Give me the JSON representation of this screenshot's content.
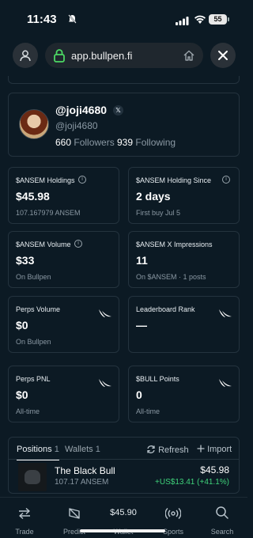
{
  "status": {
    "time": "11:43",
    "battery": "55"
  },
  "browser": {
    "url": "app.bullpen.fi"
  },
  "profile": {
    "handle": "@joji4680",
    "x_badge": "𝕏",
    "subhandle": "@joji4680",
    "followers_count": "660",
    "followers_label": "Followers",
    "following_count": "939",
    "following_label": "Following"
  },
  "stats": [
    {
      "label": "$ANSEM Holdings",
      "value": "$45.98",
      "note": "107.167979 ANSEM",
      "icon": "info-icon"
    },
    {
      "label": "$ANSEM Holding Since",
      "value": "2 days",
      "note": "First buy Jul 5",
      "icon": "info-icon"
    },
    {
      "label": "$ANSEM Volume",
      "value": "$33",
      "note": "On Bullpen",
      "icon": "info-icon"
    },
    {
      "label": "$ANSEM X Impressions",
      "value": "11",
      "note": "On $ANSEM · 1 posts",
      "icon": ""
    },
    {
      "label": "Perps Volume",
      "value": "$0",
      "note": "On Bullpen",
      "icon": "bull-horns-icon"
    },
    {
      "label": "Leaderboard Rank",
      "value": "—",
      "note": "",
      "icon": "bull-horns-icon"
    },
    {
      "label": "Perps PNL",
      "value": "$0",
      "note": "All-time",
      "icon": "bull-horns-icon"
    },
    {
      "label": "$BULL Points",
      "value": "0",
      "note": "All-time",
      "icon": "bull-horns-icon"
    }
  ],
  "positions": {
    "tab_positions": "Positions",
    "tab_positions_count": "1",
    "tab_wallets": "Wallets",
    "tab_wallets_count": "1",
    "refresh_label": "Refresh",
    "import_label": "Import",
    "item": {
      "name": "The Black Bull",
      "amount": "107.17 ANSEM",
      "value": "$45.98",
      "change": "+US$13.41 (+41.1%)"
    }
  },
  "nav": {
    "trade": "Trade",
    "predict": "Predict",
    "wallet_value": "$45.90",
    "wallet": "Wallet",
    "sports": "Sports",
    "search": "Search"
  },
  "colors": {
    "background": "#0c1a24",
    "positive": "#3fd27a",
    "card_border": "#24333e"
  }
}
